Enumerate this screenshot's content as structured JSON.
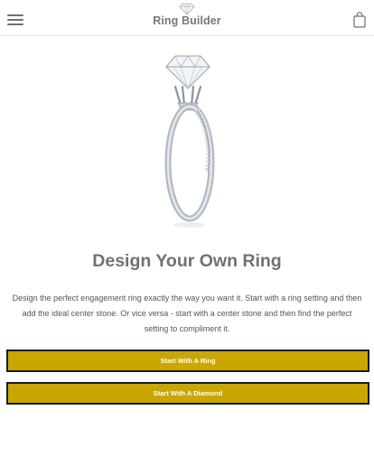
{
  "header": {
    "logo_text": "Ring Builder",
    "menu_icon": "hamburger-menu-icon",
    "bag_icon": "shopping-bag-icon"
  },
  "hero": {
    "image": "engagement-ring-image",
    "title": "Design Your Own Ring",
    "description": "Design the perfect engagement ring exactly the way you want it. Start with a ring setting and then add the ideal center stone. Or vice versa - start with a center stone and then find the perfect setting to compliment it."
  },
  "actions": {
    "start_ring": "Start With A Ring",
    "start_diamond": "Start With A Diamond"
  },
  "colors": {
    "button_bg": "#c9a700",
    "button_border": "#1a1a1a",
    "text": "#6a6a6a"
  }
}
